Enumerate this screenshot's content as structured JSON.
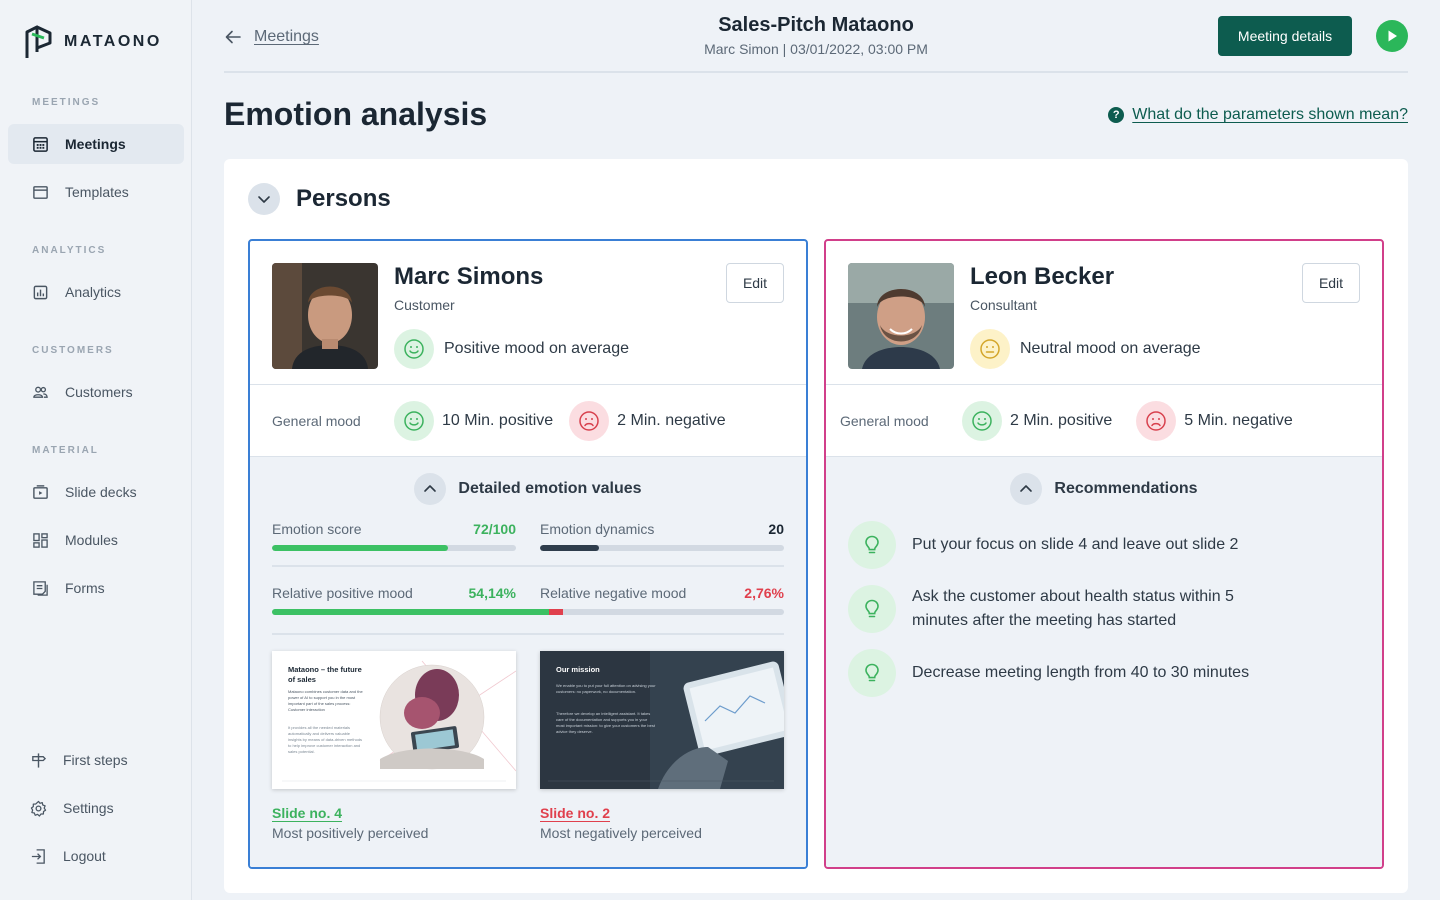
{
  "brand": {
    "name": "MATAONO"
  },
  "sidebar": {
    "sections": [
      "MEETINGS",
      "ANALYTICS",
      "CUSTOMERS",
      "MATERIAL"
    ],
    "items": [
      {
        "label": "Meetings",
        "icon": "calendar-grid-icon",
        "active": true
      },
      {
        "label": "Templates",
        "icon": "window-icon"
      },
      {
        "label": "Analytics",
        "icon": "bar-chart-icon"
      },
      {
        "label": "Customers",
        "icon": "users-icon"
      },
      {
        "label": "Slide decks",
        "icon": "slides-icon"
      },
      {
        "label": "Modules",
        "icon": "grid-icon"
      },
      {
        "label": "Forms",
        "icon": "form-icon"
      }
    ],
    "bottom": [
      {
        "label": "First steps",
        "icon": "signpost-icon"
      },
      {
        "label": "Settings",
        "icon": "gear-icon"
      },
      {
        "label": "Logout",
        "icon": "logout-icon"
      }
    ]
  },
  "header": {
    "back_label": "Meetings",
    "title": "Sales-Pitch Mataono",
    "subtitle": "Marc Simon | 03/01/2022, 03:00 PM",
    "details_button": "Meeting details"
  },
  "page": {
    "title": "Emotion analysis",
    "help_link": "What do the parameters shown mean?",
    "help_icon_glyph": "?"
  },
  "persons": {
    "title": "Persons",
    "left": {
      "name": "Marc Simons",
      "role": "Customer",
      "mood": "Positive mood on average",
      "edit": "Edit",
      "general_label": "General mood",
      "positive": "10 Min. positive",
      "negative": "2 Min. negative",
      "section_title": "Detailed emotion values",
      "metrics": {
        "score_label": "Emotion score",
        "score_value": "72/100",
        "score_fraction": 0.72,
        "dynamics_label": "Emotion dynamics",
        "dynamics_value": "20",
        "dynamics_fraction": 0.24,
        "pos_label": "Relative positive mood",
        "pos_value": "54,14%",
        "pos_fraction": 0.5414,
        "neg_label": "Relative negative mood",
        "neg_value": "2,76%",
        "neg_fraction": 0.0276
      },
      "slides": [
        {
          "link": "Slide no. 4",
          "caption": "Most positively perceived",
          "title": "Mataono – the future of sales",
          "body": "Mataono combines customer data and the power of AI to support you in the most important part of the sales process: Customer interaction",
          "body2": "It provides all the needed materials automatically and delivers valuable insights by means of data-driven methods to help improve customer interaction and sales potential."
        },
        {
          "link": "Slide no. 2",
          "caption": "Most negatively perceived",
          "title": "Our mission",
          "body": "We enable you to put your full attention on advising your customers: no paperwork, no documentation.",
          "body2": "Therefore we develop an intelligent assistant. It takes care of the documentation and supports you in your most important mission: to give your customers the best advice they deserve."
        }
      ]
    },
    "right": {
      "name": "Leon Becker",
      "role": "Consultant",
      "mood": "Neutral mood on average",
      "edit": "Edit",
      "general_label": "General mood",
      "positive": "2 Min. positive",
      "negative": "5 Min. negative",
      "section_title": "Recommendations",
      "recommendations": [
        "Put your focus on slide 4 and leave out slide 2",
        "Ask the customer about health status within 5 minutes after the meeting has started",
        "Decrease meeting length from 40 to 30 minutes"
      ]
    }
  },
  "colors": {
    "accent": "#0d5c4f",
    "positive": "#3cc164",
    "negative": "#e0404d",
    "dark_bar": "#2f3d4c",
    "left_border": "#3a7fd5",
    "right_border": "#d13f8a"
  }
}
